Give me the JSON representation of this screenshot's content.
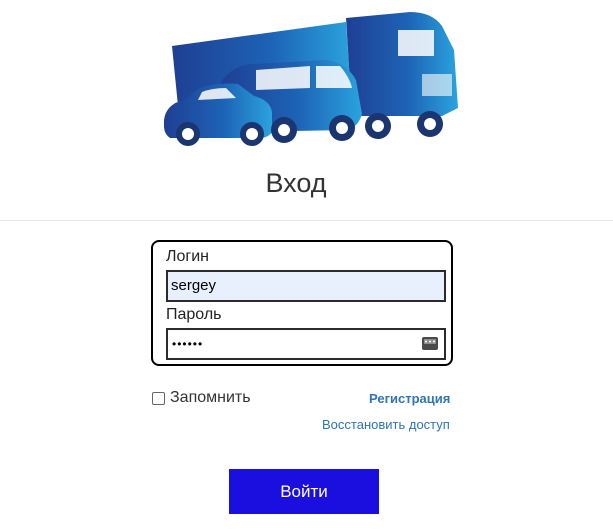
{
  "header": {
    "logo_icon": "trucks-cars-logo",
    "title": "Вход"
  },
  "form": {
    "login_label": "Логин",
    "login_value": "sergey",
    "password_label": "Пароль",
    "password_masked": "••••••",
    "password_key_icon": "key-icon"
  },
  "options": {
    "remember_label": "Запомнить",
    "remember_checked": false,
    "register_label": "Регистрация",
    "restore_label": "Восстановить доступ"
  },
  "actions": {
    "submit_label": "Войти"
  },
  "colors": {
    "accent": "#1a0fdf",
    "link": "#2f74b5",
    "autofill_bg": "#e8f0fe"
  }
}
